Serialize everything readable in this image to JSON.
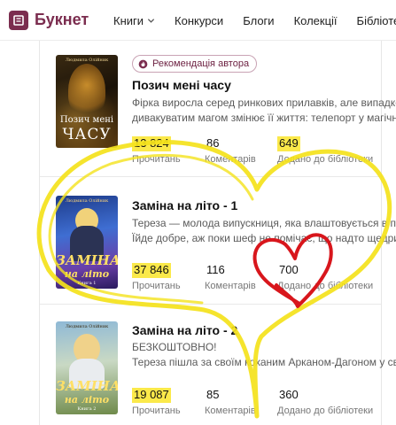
{
  "header": {
    "logo_text": "Букнет",
    "nav": [
      {
        "label": "Книги"
      },
      {
        "label": "Конкурси"
      },
      {
        "label": "Блоги"
      },
      {
        "label": "Колекції"
      },
      {
        "label": "Бібліотека"
      }
    ]
  },
  "books": [
    {
      "badge": "Рекомендація автора",
      "title": "Позич мені часу",
      "desc": [
        "Фірка виросла серед ринкових прилавків, але випадкова зустріч з",
        "дивакуватим магом змінює її життя: телепорт у магічний світ"
      ],
      "cover": {
        "author": "Людмила Олійник",
        "line1": "Позич мені",
        "line2": "ЧАСУ"
      },
      "stats": [
        {
          "value": "13 824",
          "label": "Прочитань"
        },
        {
          "value": "86",
          "label": "Коментарів"
        },
        {
          "value": "649",
          "label": "Додано до бібліотеки"
        }
      ]
    },
    {
      "title": "Заміна на літо - 1",
      "desc": [
        "Тереза — молода випускниця, яка влаштовується в престижну фірму.",
        "Їйде добре, аж поки шеф не помічає, що надто щедрий..."
      ],
      "cover": {
        "author": "Людмила Олійник",
        "line1": "ЗАМІНА",
        "line2": "на літо",
        "line3": "Книга 1"
      },
      "stats": [
        {
          "value": "37 846",
          "label": "Прочитань"
        },
        {
          "value": "116",
          "label": "Коментарів"
        },
        {
          "value": "700",
          "label": "Додано до бібліотеки"
        }
      ]
    },
    {
      "title": "Заміна на літо - 2",
      "desc": [
        "БЕЗКОШТОВНО!",
        "Тереза пішла за своїм коханим Арканом-Дагоном у світ магії"
      ],
      "cover": {
        "author": "Людмила Олійник",
        "line1": "ЗАМІНА",
        "line2": "на літо",
        "line3": "Книга 2"
      },
      "stats": [
        {
          "value": "19 087",
          "label": "Прочитань"
        },
        {
          "value": "85",
          "label": "Коментарів"
        },
        {
          "value": "360",
          "label": "Додано до бібліотеки"
        }
      ]
    }
  ],
  "colors": {
    "brand": "#7b2d4f",
    "highlight": "#fbe94a",
    "scribble_yellow": "#f4e21b",
    "scribble_red": "#d8161c"
  }
}
